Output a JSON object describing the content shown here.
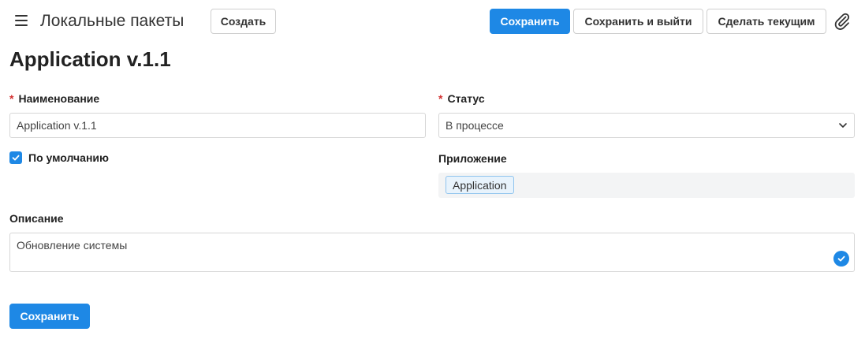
{
  "header": {
    "title": "Локальные пакеты",
    "create_label": "Создать",
    "save_label": "Сохранить",
    "save_exit_label": "Сохранить и выйти",
    "make_current_label": "Сделать текущим"
  },
  "page_title": "Application v.1.1",
  "form": {
    "name": {
      "label": "Наименование",
      "required_mark": "*",
      "value": "Application v.1.1"
    },
    "status": {
      "label": "Статус",
      "required_mark": "*",
      "value": "В процессе"
    },
    "default": {
      "label": "По умолчанию",
      "checked": true
    },
    "application": {
      "label": "Приложение",
      "tag": "Application"
    },
    "description": {
      "label": "Описание",
      "value": "Обновление системы"
    }
  },
  "footer": {
    "save_label": "Сохранить"
  },
  "colors": {
    "primary": "#1e88e5",
    "required": "#d32f2f"
  },
  "icons": [
    "menu-icon",
    "paperclip-icon",
    "chevron-down-icon",
    "checkmark-icon",
    "check-circle-icon"
  ]
}
